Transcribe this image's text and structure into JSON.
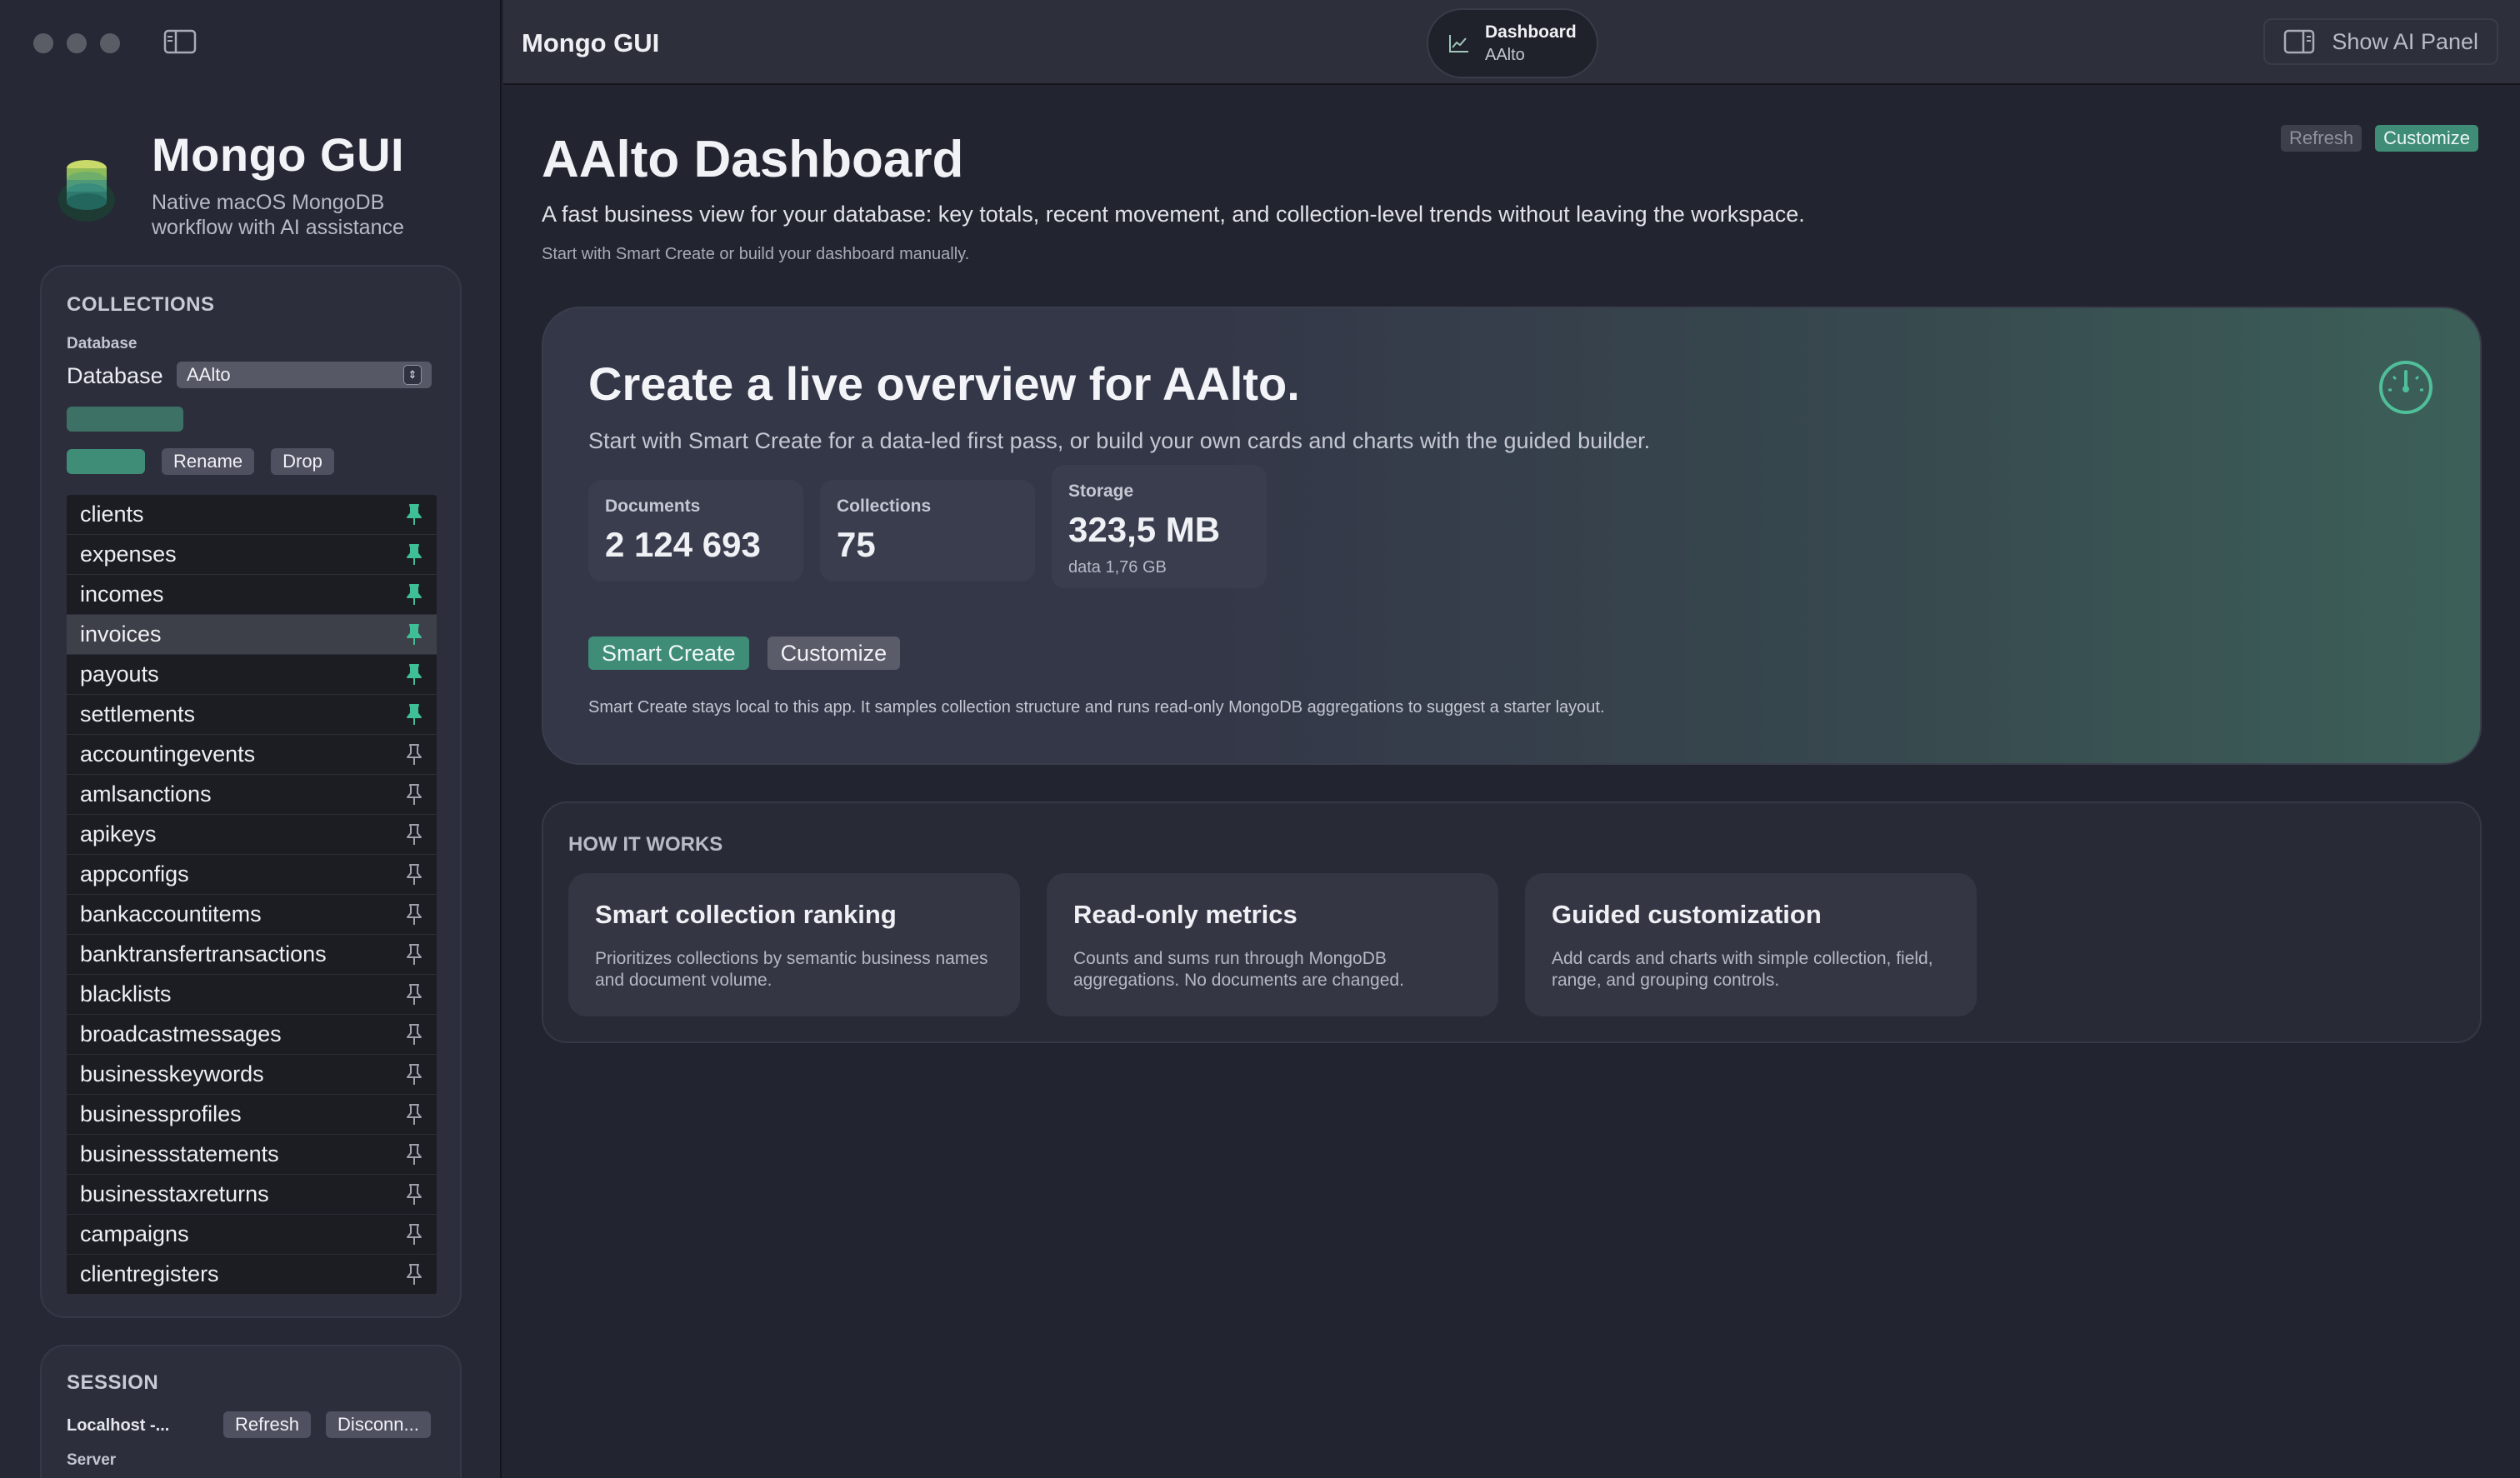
{
  "app": {
    "title": "Mongo GUI"
  },
  "brand": {
    "title": "Mongo GUI",
    "subtitle": "Native macOS MongoDB workflow with AI assistance"
  },
  "collections_panel": {
    "title": "COLLECTIONS",
    "database_small_label": "Database",
    "database_label": "Database",
    "database_value": "AAlto",
    "rename_label": "Rename",
    "drop_label": "Drop",
    "items": [
      {
        "name": "clients",
        "pinned": true
      },
      {
        "name": "expenses",
        "pinned": true
      },
      {
        "name": "incomes",
        "pinned": true
      },
      {
        "name": "invoices",
        "pinned": true,
        "selected": true
      },
      {
        "name": "payouts",
        "pinned": true
      },
      {
        "name": "settlements",
        "pinned": true
      },
      {
        "name": "accountingevents",
        "pinned": false
      },
      {
        "name": "amlsanctions",
        "pinned": false
      },
      {
        "name": "apikeys",
        "pinned": false
      },
      {
        "name": "appconfigs",
        "pinned": false
      },
      {
        "name": "bankaccountitems",
        "pinned": false
      },
      {
        "name": "banktransfertransactions",
        "pinned": false
      },
      {
        "name": "blacklists",
        "pinned": false
      },
      {
        "name": "broadcastmessages",
        "pinned": false
      },
      {
        "name": "businesskeywords",
        "pinned": false
      },
      {
        "name": "businessprofiles",
        "pinned": false
      },
      {
        "name": "businessstatements",
        "pinned": false
      },
      {
        "name": "businesstaxreturns",
        "pinned": false
      },
      {
        "name": "campaigns",
        "pinned": false
      },
      {
        "name": "clientregisters",
        "pinned": false
      }
    ]
  },
  "session_panel": {
    "title": "SESSION",
    "host": "Localhost -...",
    "refresh_label": "Refresh",
    "disconnect_label": "Disconn...",
    "server_label": "Server"
  },
  "toolbar": {
    "title": "Mongo GUI",
    "tab_title": "Dashboard",
    "tab_subtitle": "AAlto",
    "ai_panel_label": "Show AI Panel"
  },
  "dashboard": {
    "refresh_label": "Refresh",
    "customize_label": "Customize",
    "title": "AAlto Dashboard",
    "description": "A fast business view for your database: key totals, recent movement, and collection-level trends without leaving the workspace.",
    "hint": "Start with Smart Create or build your dashboard manually.",
    "hero": {
      "title": "Create a live overview for AAlto.",
      "subtitle": "Start with Smart Create for a data-led first pass, or build your own cards and charts with the guided builder.",
      "stats": {
        "documents_label": "Documents",
        "documents_value": "2 124 693",
        "collections_label": "Collections",
        "collections_value": "75",
        "storage_label": "Storage",
        "storage_value": "323,5 MB",
        "storage_note": "data 1,76 GB"
      },
      "smart_create_label": "Smart Create",
      "customize_label": "Customize",
      "note": "Smart Create stays local to this app. It samples collection structure and runs read-only MongoDB aggregations to suggest a starter layout."
    },
    "how_it_works": {
      "title": "HOW IT WORKS",
      "cards": [
        {
          "title": "Smart collection ranking",
          "desc": "Prioritizes collections by semantic business names and document volume."
        },
        {
          "title": "Read-only metrics",
          "desc": "Counts and sums run through MongoDB aggregations. No documents are changed."
        },
        {
          "title": "Guided customization",
          "desc": "Add cards and charts with simple collection, field, range, and grouping controls."
        }
      ]
    }
  },
  "colors": {
    "accent": "#3f8d77",
    "pin_active": "#3fbf96"
  }
}
